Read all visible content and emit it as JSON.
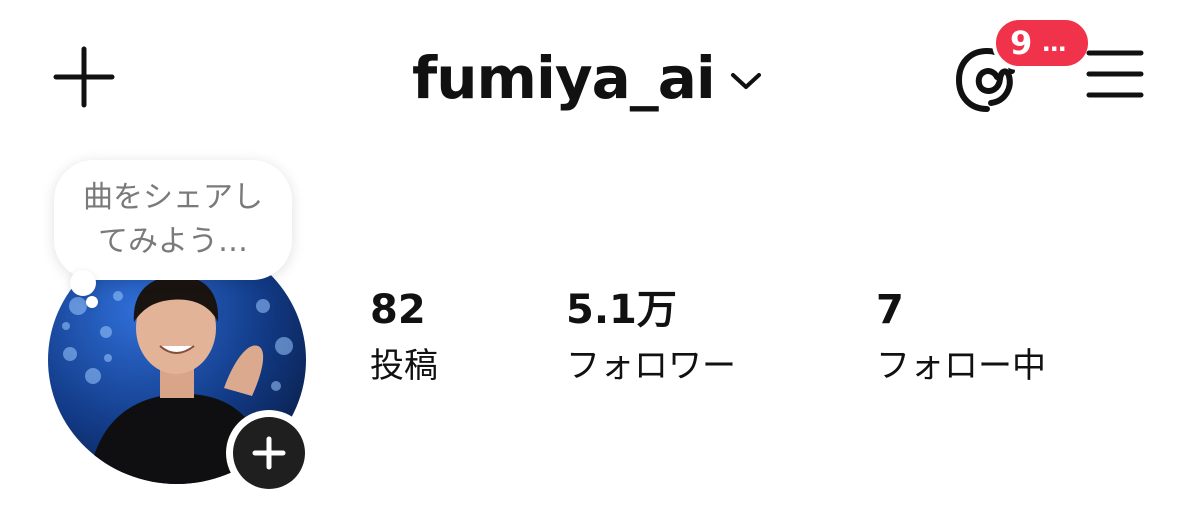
{
  "header": {
    "username": "fumiya_ai",
    "threads_badge": {
      "count": "9",
      "overflow": "…"
    },
    "icons": {
      "add": "plus-icon",
      "switcher": "chevron-down-icon",
      "threads": "threads-icon",
      "menu": "hamburger-menu-icon"
    }
  },
  "note": {
    "line1": "曲をシェアし",
    "line2": "てみよう…"
  },
  "stats": [
    {
      "value": "82",
      "label": "投稿"
    },
    {
      "value": "5.1万",
      "label": "フォロワー"
    },
    {
      "value": "7",
      "label": "フォロー中"
    }
  ],
  "colors": {
    "badge": "#f0324a",
    "text": "#111111",
    "note_text": "#7a7a7a"
  }
}
